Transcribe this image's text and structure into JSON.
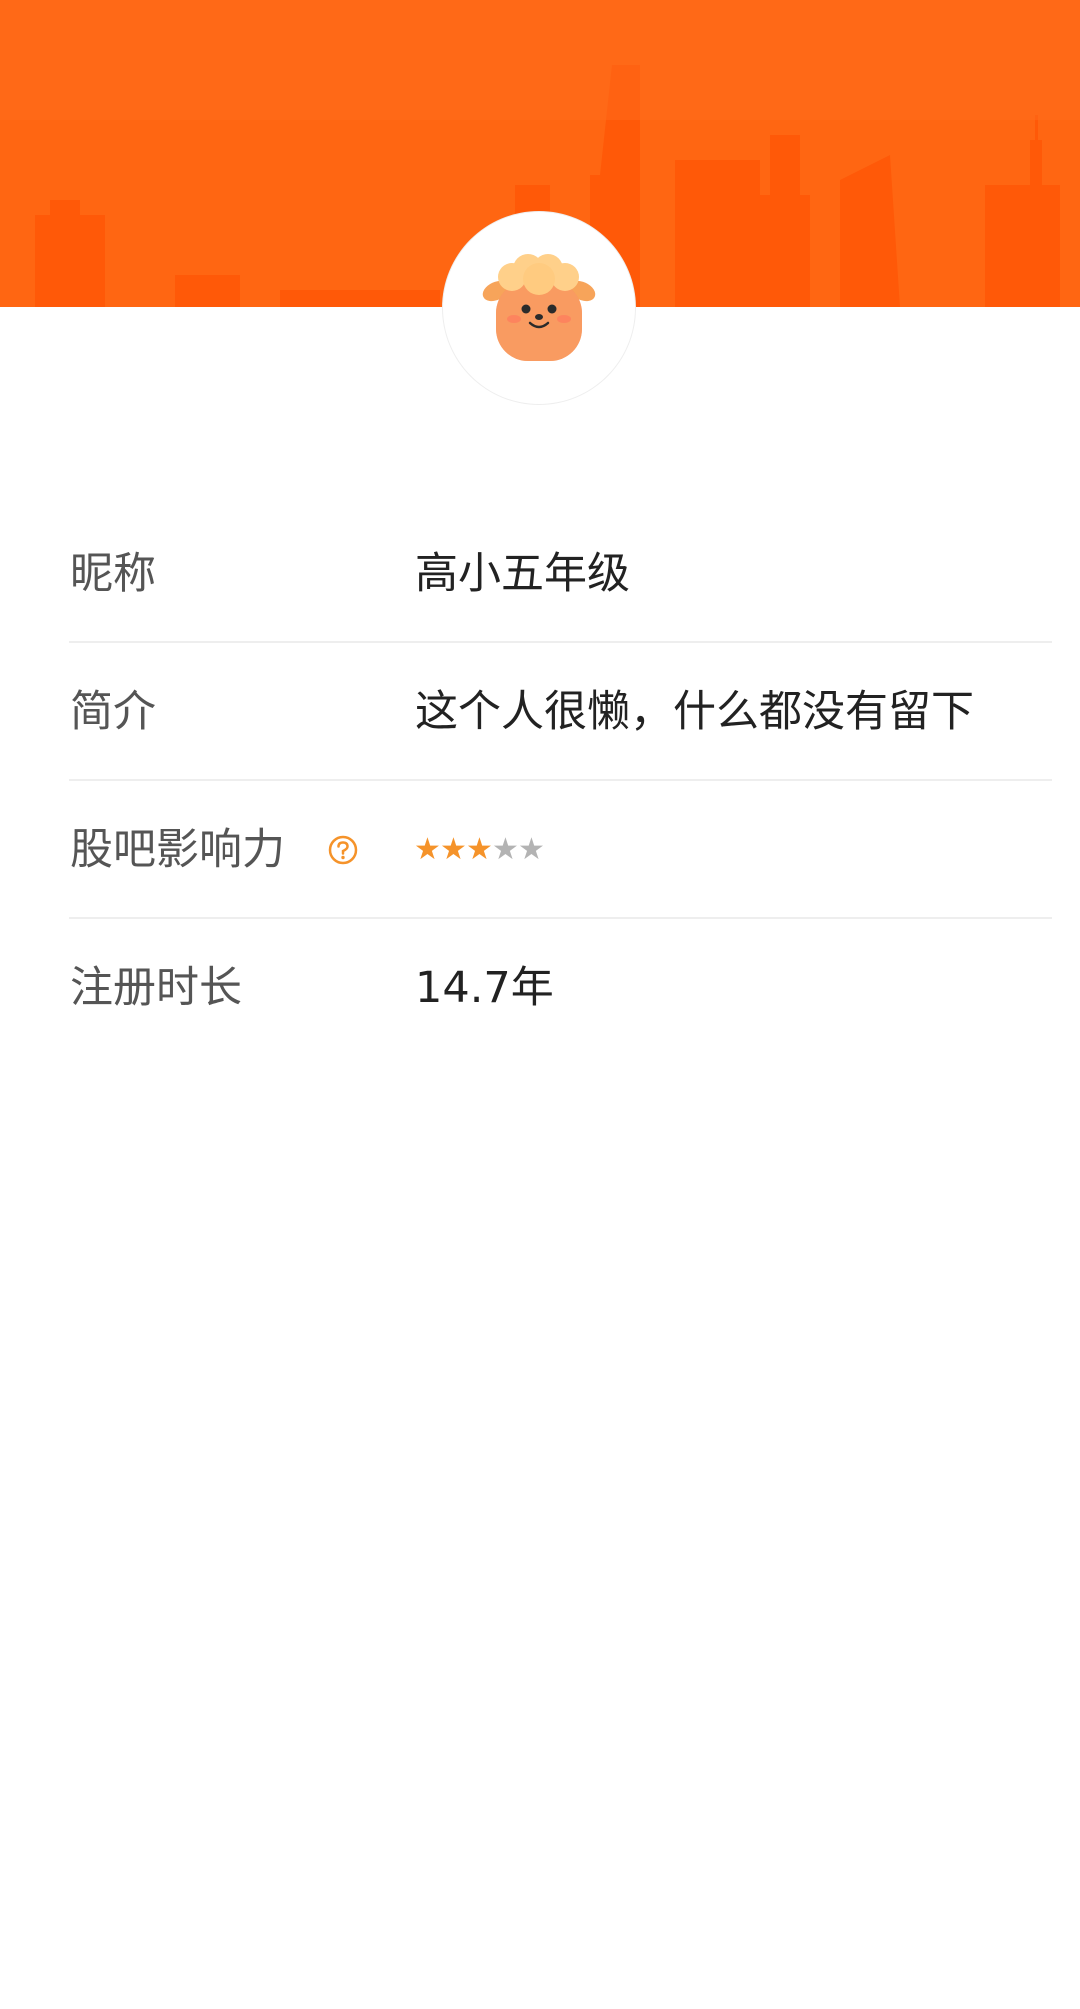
{
  "profile": {
    "fields": [
      {
        "label": "昵称",
        "value": "高小五年级"
      },
      {
        "label": "简介",
        "value": "这个人很懒，什么都没有留下"
      },
      {
        "label": "股吧影响力",
        "rating": 3,
        "rating_max": 5
      },
      {
        "label": "注册时长",
        "value": "14.7年"
      }
    ]
  },
  "icons": {
    "avatar": "cartoon-sheep-mascot",
    "help": "question-circle-icon",
    "star": "star-icon"
  },
  "colors": {
    "banner": "#ff5f0a",
    "star_active": "#f5932a",
    "star_inactive": "#b3b3b3",
    "help_icon": "#f5932a"
  }
}
